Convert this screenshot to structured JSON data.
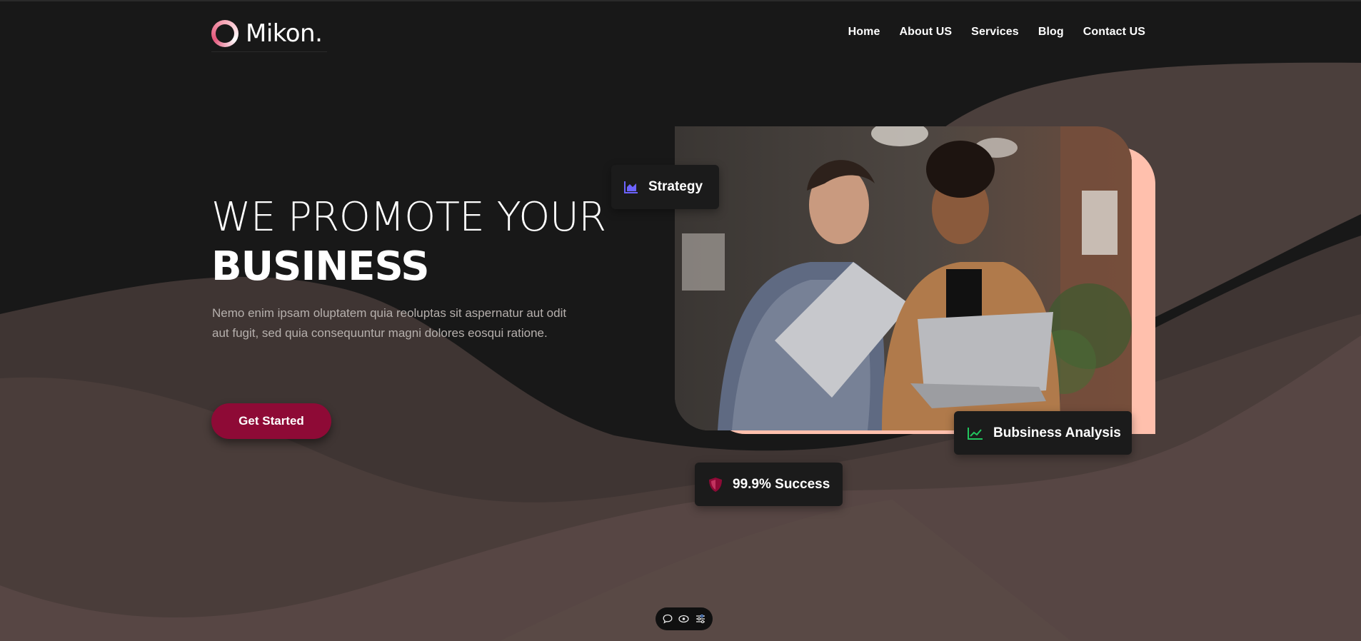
{
  "brand": {
    "name": "Mikon."
  },
  "nav": {
    "items": [
      "Home",
      "About US",
      "Services",
      "Blog",
      "Contact US"
    ]
  },
  "hero": {
    "line1": "WE PROMOTE YOUR",
    "line2": "BUSINESS",
    "description": "Nemo enim ipsam oluptatem quia reoluptas sit aspernatur aut odit aut fugit, sed quia consequuntur magni dolores eosqui ratione.",
    "cta_label": "Get Started"
  },
  "badges": {
    "strategy": {
      "label": "Strategy",
      "icon": "area-chart-icon",
      "color": "#6c63ff"
    },
    "analysis": {
      "label": "Bubsiness Analysis",
      "icon": "line-chart-icon",
      "color": "#22c55e"
    },
    "success": {
      "label": "99.9% Success",
      "icon": "shield-icon",
      "color": "#8e0a36"
    }
  },
  "toolbar": {
    "icons": [
      "comment-icon",
      "eye-icon",
      "settings-sliders-icon"
    ]
  },
  "colors": {
    "background": "#181818",
    "wave_dark": "#3d3331",
    "wave_mid": "#4b3f3c",
    "wave_light": "#5a4946",
    "accent": "#8e0a36",
    "peach": "#ffc0ad"
  }
}
